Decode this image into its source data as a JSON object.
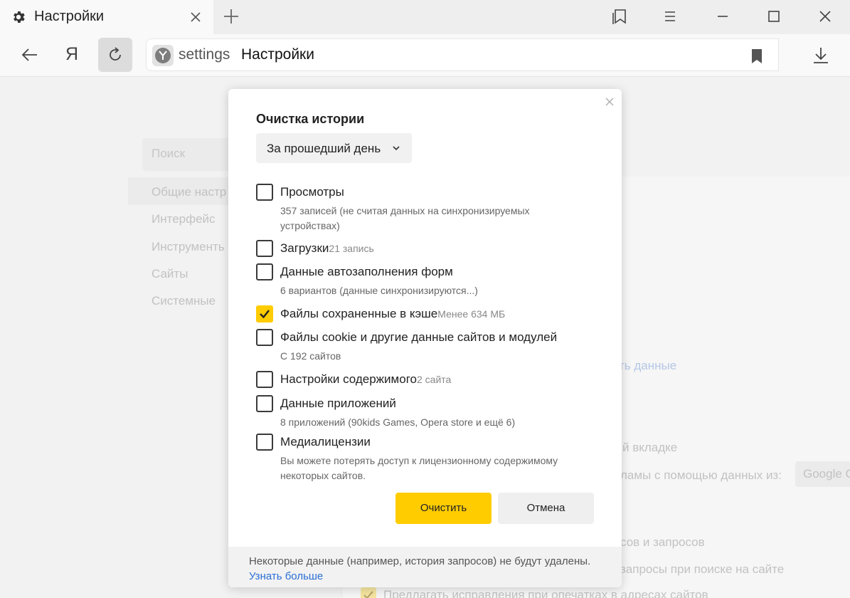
{
  "browser": {
    "tab_title": "Настройки",
    "address_host": "settings",
    "address_title": "Настройки",
    "home_label": "Я"
  },
  "settings_page": {
    "search_placeholder": "Поиск",
    "nav": [
      "Общие настр",
      "Интерфейс",
      "Инструменть",
      "Сайты",
      "Системные"
    ],
    "bg_texts": {
      "data_link": "ть данные",
      "tab_text": "й вкладке",
      "ads_text": "ламы с помощью данных из:",
      "engine": "Google C",
      "queries": "сов и запросов",
      "site_search": "запросы при поиске на сайте",
      "typos": "Предлагать исправления при опечатках в адресах сайтов"
    }
  },
  "dialog": {
    "title": "Очистка истории",
    "period": "За прошедший день",
    "items": [
      {
        "label": "Просмотры",
        "inline": "",
        "sub": "357 записей (не считая данных на синхронизируемых устройствах)",
        "checked": false
      },
      {
        "label": "Загрузки",
        "inline": "21 запись",
        "sub": "",
        "checked": false
      },
      {
        "label": "Данные автозаполнения форм",
        "inline": "",
        "sub": "6 вариантов (данные синхронизируются...)",
        "checked": false
      },
      {
        "label": "Файлы сохраненные в кэше",
        "inline": "Менее 634 МБ",
        "sub": "",
        "checked": true
      },
      {
        "label": "Файлы cookie и другие данные сайтов и модулей",
        "inline": "",
        "sub": "С 192 сайтов",
        "checked": false
      },
      {
        "label": "Настройки содержимого",
        "inline": "2 сайта",
        "sub": "",
        "checked": false
      },
      {
        "label": "Данные приложений",
        "inline": "",
        "sub": "8 приложений (90kids Games, Opera store и ещё 6)",
        "checked": false
      },
      {
        "label": "Медиалицензии",
        "inline": "",
        "sub": "Вы можете потерять доступ к лицензионному содержимому некоторых сайтов.",
        "checked": false
      }
    ],
    "clear_button": "Очистить",
    "cancel_button": "Отмена",
    "footer_note": "Некоторые данные (например, история запросов) не будут удалены.",
    "footer_link": "Узнать больше"
  },
  "colors": {
    "accent": "#ffcc00",
    "link": "#2a6fd6"
  }
}
